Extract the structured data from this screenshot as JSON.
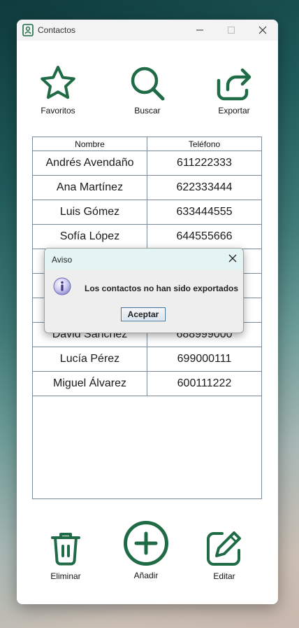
{
  "window": {
    "title": "Contactos"
  },
  "toolbar": {
    "favoritos": "Favoritos",
    "buscar": "Buscar",
    "exportar": "Exportar"
  },
  "table": {
    "headers": [
      "Nombre",
      "Teléfono"
    ],
    "rows": [
      [
        "Andrés Avendaño",
        "611222333"
      ],
      [
        "Ana Martínez",
        "622333444"
      ],
      [
        "Luis Gómez",
        "633444555"
      ],
      [
        "Sofía López",
        "644555666"
      ],
      [
        "",
        ""
      ],
      [
        "",
        ""
      ],
      [
        "",
        ""
      ],
      [
        "David Sánchez",
        "688999000"
      ],
      [
        "Lucía Pérez",
        "699000111"
      ],
      [
        "Miguel Álvarez",
        "600111222"
      ]
    ]
  },
  "dialog": {
    "title": "Aviso",
    "message": "Los contactos no han sido exportados",
    "button": "Aceptar",
    "icon": "info-icon"
  },
  "bottom": {
    "eliminar": "Eliminar",
    "anadir": "Añadir",
    "editar": "Editar"
  },
  "colors": {
    "accent": "#1f6b45",
    "grid": "#7a8a99",
    "dialog_bar": "#e4f4f4"
  },
  "icons": [
    "star-icon",
    "search-icon",
    "export-icon",
    "trash-icon",
    "plus-circle-icon",
    "edit-icon"
  ]
}
